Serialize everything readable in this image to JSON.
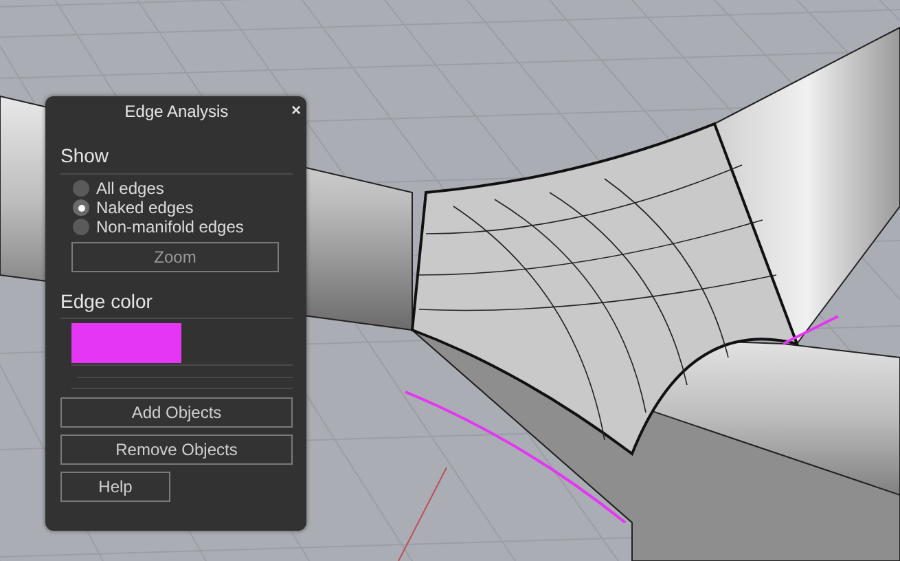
{
  "panel": {
    "title": "Edge Analysis",
    "close_glyph": "×"
  },
  "show": {
    "heading": "Show",
    "options": [
      {
        "label": "All edges",
        "selected": false
      },
      {
        "label": "Naked edges",
        "selected": true
      },
      {
        "label": "Non-manifold edges",
        "selected": false
      }
    ],
    "zoom_button": "Zoom",
    "zoom_disabled": true
  },
  "edge_color": {
    "heading": "Edge color",
    "color": "#e535f5"
  },
  "buttons": [
    "Add Objects",
    "Remove Objects"
  ],
  "help_button": "Help"
}
